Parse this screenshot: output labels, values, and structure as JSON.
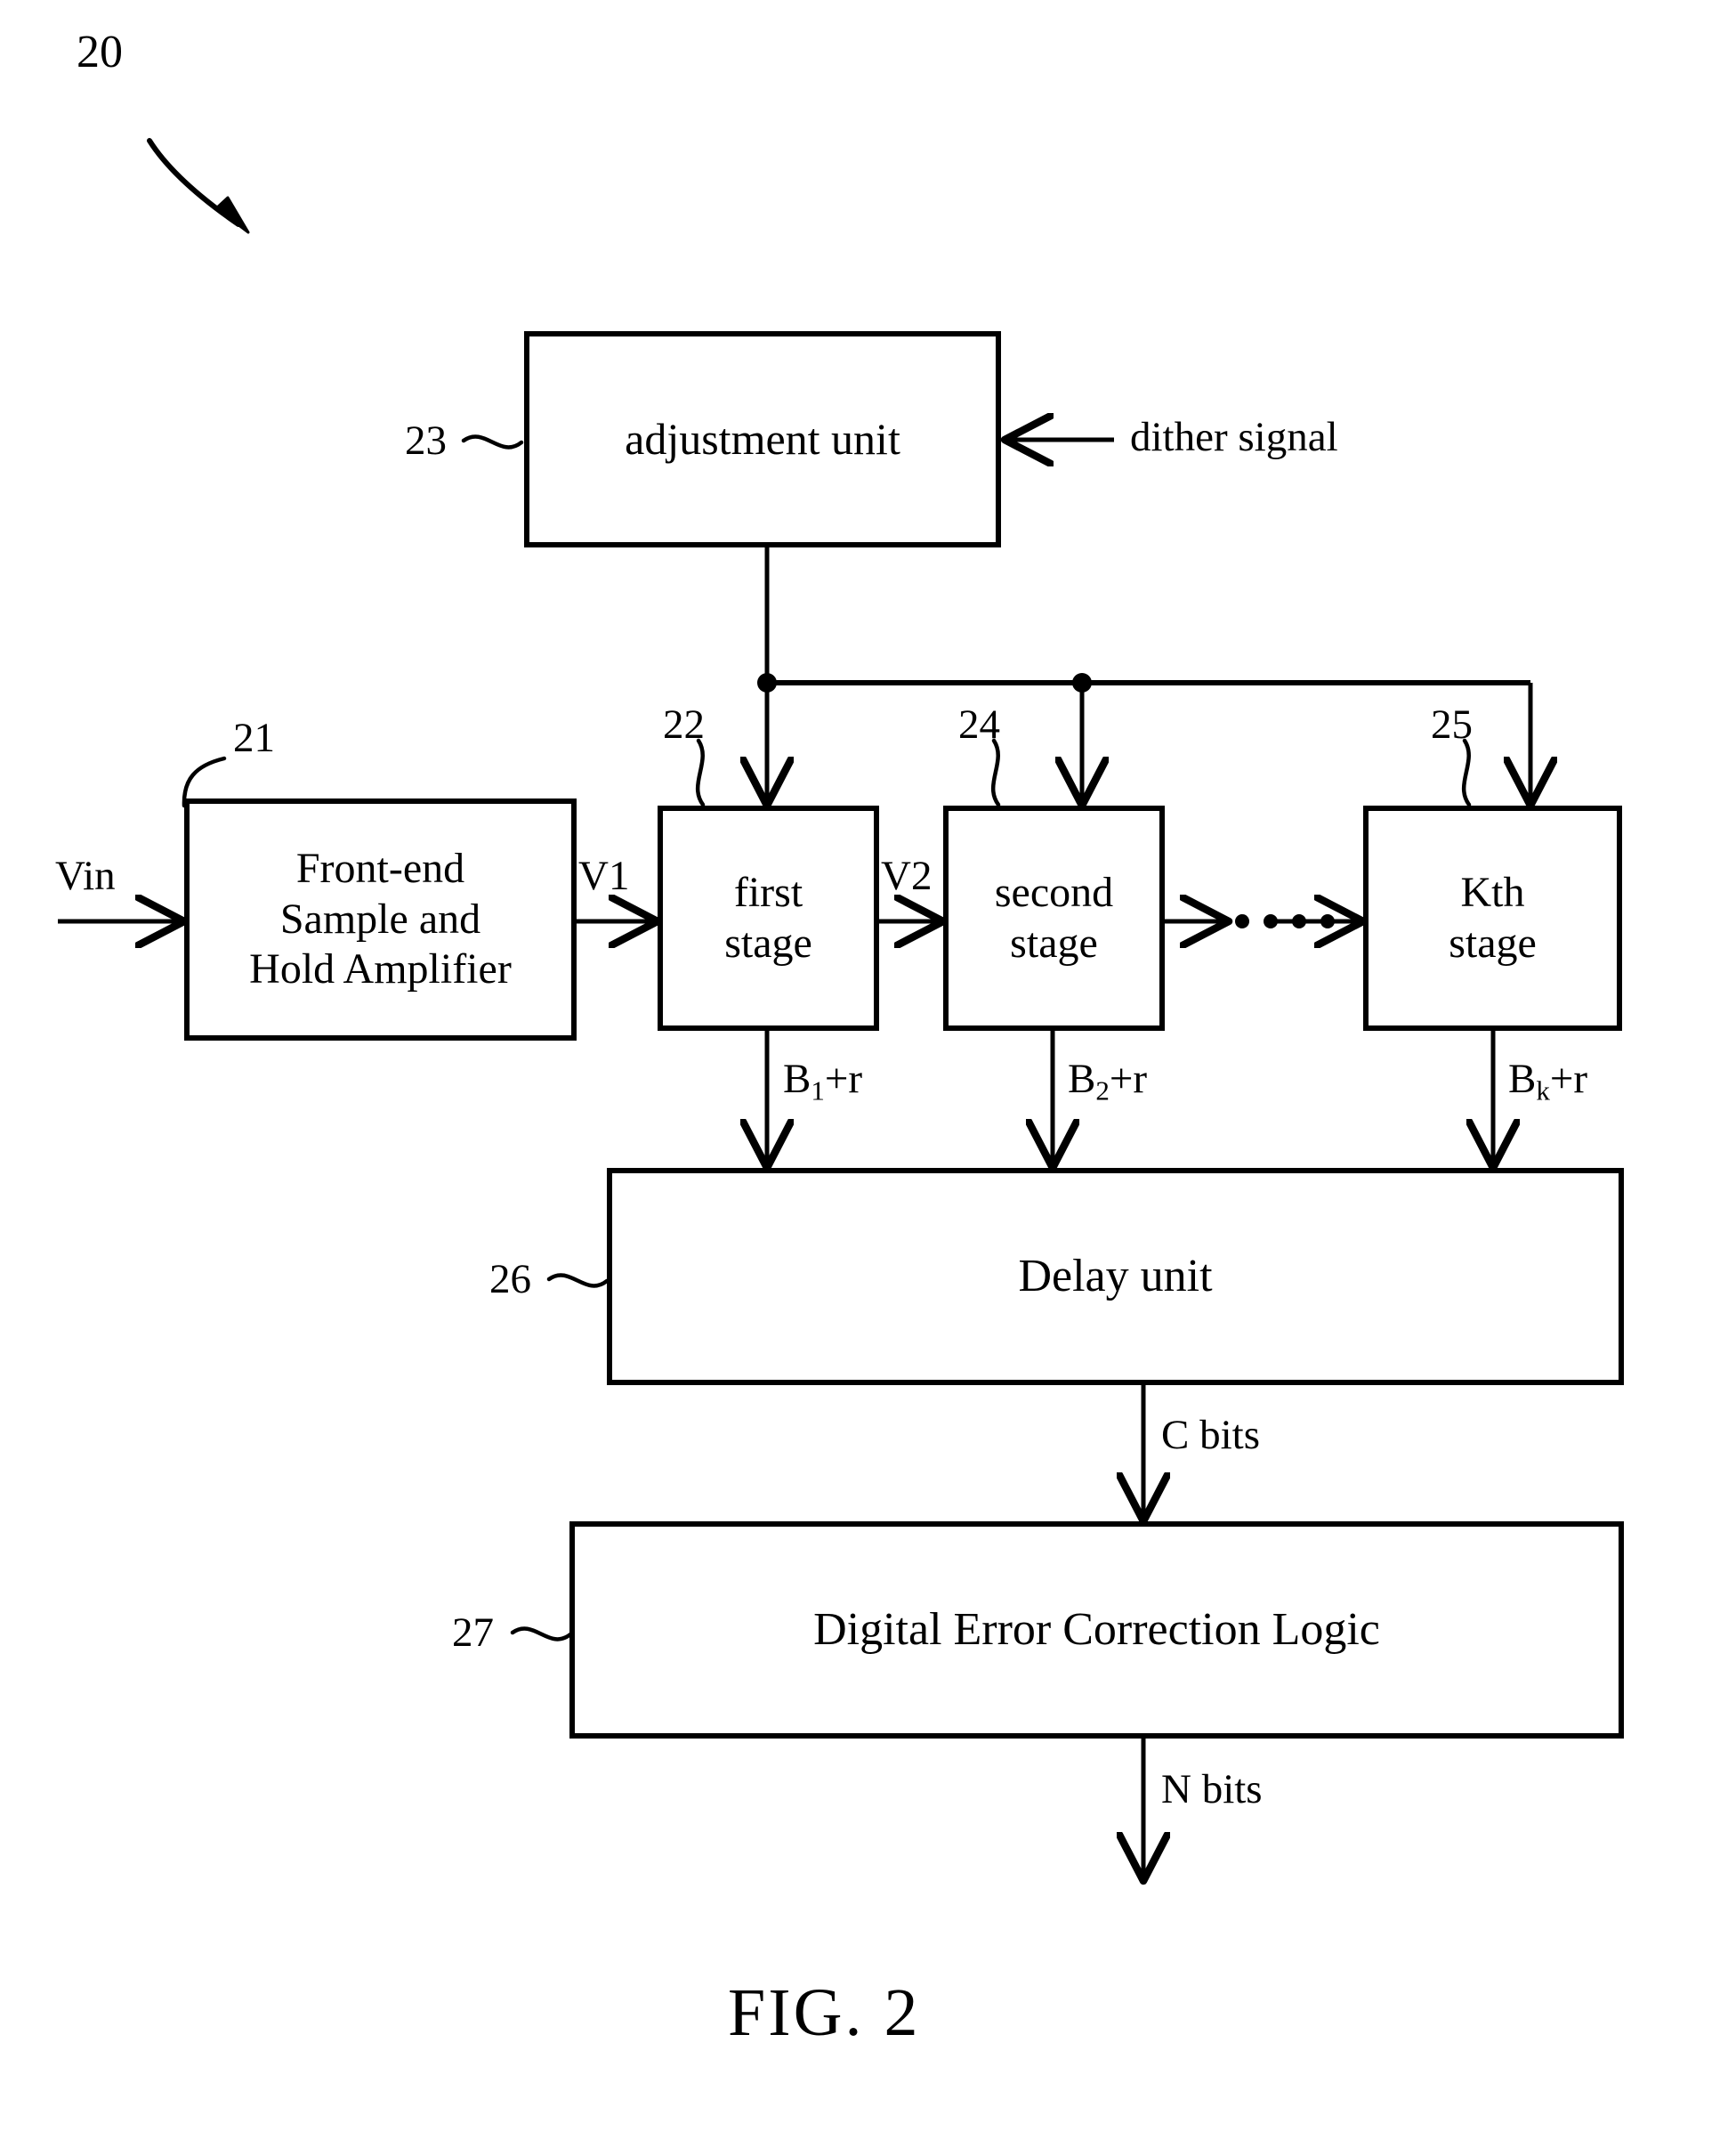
{
  "figure": {
    "caption": "FIG.  2",
    "system_ref": "20"
  },
  "blocks": [
    {
      "id": "adjustment-unit",
      "label": "adjustment unit",
      "ref": "23"
    },
    {
      "id": "front-end-sha",
      "label": "Front-end\nSample and\nHold Amplifier",
      "ref": "21"
    },
    {
      "id": "first-stage",
      "label": "first\nstage",
      "ref": "22"
    },
    {
      "id": "second-stage",
      "label": "second\nstage",
      "ref": "24"
    },
    {
      "id": "kth-stage",
      "label": "Kth\nstage",
      "ref": "25"
    },
    {
      "id": "delay-unit",
      "label": "Delay unit",
      "ref": "26"
    },
    {
      "id": "digital-error-correction-logic",
      "label": "Digital Error Correction Logic",
      "ref": "27"
    }
  ],
  "signals": {
    "vin": "Vin",
    "dither": "dither signal",
    "v1": "V1",
    "v2": "V2",
    "b1": {
      "base": "B",
      "sub": "1",
      "tail": "+r"
    },
    "b2": {
      "base": "B",
      "sub": "2",
      "tail": "+r"
    },
    "bk": {
      "base": "B",
      "sub": "k",
      "tail": "+r"
    },
    "c_bits": "C bits",
    "n_bits": "N bits"
  },
  "colors": {
    "stroke": "#000000",
    "background": "#ffffff"
  }
}
